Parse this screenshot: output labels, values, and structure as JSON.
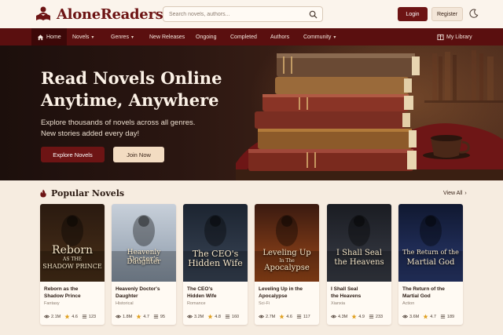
{
  "header": {
    "logo_text": "AloneReaders",
    "search_placeholder": "Search novels, authors...",
    "login_label": "Login",
    "register_label": "Register",
    "theme_icon": "moon-icon"
  },
  "nav": {
    "items": [
      {
        "label": "Home"
      },
      {
        "label": "Novels"
      },
      {
        "label": "Genres"
      },
      {
        "label": "New Releases"
      },
      {
        "label": "Ongoing"
      },
      {
        "label": "Completed"
      },
      {
        "label": "Authors"
      },
      {
        "label": "Community"
      }
    ],
    "library_label": "My Library"
  },
  "hero": {
    "title_line1": "Read Novels Online",
    "title_line2": "Anytime, Anywhere",
    "subtitle_line1": "Explore thousands of novels across all genres.",
    "subtitle_line2": "New stories added every day!",
    "explore_label": "Explore Novels",
    "join_label": "Join Now"
  },
  "popular": {
    "title": "Popular Novels",
    "view_all": "View All",
    "novels": [
      {
        "cover_text": "Reborn",
        "cover_sub": "AS THE",
        "cover_text2": "SHADOW PRINCE",
        "title_line1": "Reborn as the",
        "title_line2": "Shadow Prince",
        "genre": "Fantasy",
        "views": "2.1M",
        "rating": "4.6",
        "chapters": "123",
        "accent": "#c9a45a"
      },
      {
        "cover_text": "Heavenly Doctor's",
        "cover_text2": "Daughter",
        "title_line1": "Heavenly Doctor's",
        "title_line2": "Daughter",
        "genre": "Historical",
        "views": "1.8M",
        "rating": "4.7",
        "chapters": "95",
        "accent": "#9fb3c8"
      },
      {
        "cover_text": "The CEO's",
        "cover_text2": "Hidden Wife",
        "title_line1": "The CEO's",
        "title_line2": "Hidden Wife",
        "genre": "Romance",
        "views": "3.2M",
        "rating": "4.8",
        "chapters": "160",
        "accent": "#7c8fa8"
      },
      {
        "cover_text": "Leveling Up",
        "cover_sub": "In The",
        "cover_text2": "Apocalypse",
        "title_line1": "Leveling Up in the",
        "title_line2": "Apocalypse",
        "genre": "Sci-Fi",
        "views": "2.7M",
        "rating": "4.6",
        "chapters": "117",
        "accent": "#e07a3a"
      },
      {
        "cover_text": "I Shall Seal",
        "cover_text2": "the Heavens",
        "title_line1": "I Shall Seal",
        "title_line2": "the Heavens",
        "genre": "Xianxia",
        "views": "4.3M",
        "rating": "4.9",
        "chapters": "233",
        "accent": "#9aa0a8"
      },
      {
        "cover_text": "The Return of the",
        "cover_text2": "Martial God",
        "title_line1": "The Return of the",
        "title_line2": "Martial God",
        "genre": "Action",
        "views": "3.6M",
        "rating": "4.7",
        "chapters": "189",
        "accent": "#4c6fd0"
      }
    ]
  },
  "colors": {
    "brand": "#6d1414",
    "nav_bg": "#5a0f0f",
    "page_bg": "#f6ece0",
    "star": "#e0a020"
  }
}
